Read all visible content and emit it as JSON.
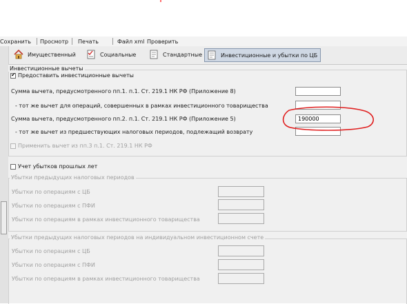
{
  "menu": {
    "items": [
      "Сохранить",
      "Просмотр",
      "Печать",
      "Файл xml",
      "Проверить"
    ]
  },
  "tabs": [
    {
      "label": "Имущественный",
      "icon": "house-icon"
    },
    {
      "label": "Социальные",
      "icon": "checklist-icon"
    },
    {
      "label": "Стандартные",
      "icon": "document-icon"
    },
    {
      "label": "Инвестиционные и убытки по ЦБ",
      "icon": "document-icon",
      "active": true
    }
  ],
  "invest": {
    "group_title": "Инвестиционные вычеты",
    "provide_label": "Предоставить инвестиционные вычеты",
    "provide_checked": true,
    "rows": [
      {
        "label": "Сумма вычета, предусмотренного пп.1. п.1. Ст. 219.1 НК РФ (Приложение 8)",
        "value": ""
      },
      {
        "label": "- тот же вычет для операций, совершенных в рамках инвестиционного товарищества",
        "value": ""
      },
      {
        "label": "Сумма вычета, предусмотренного пп.2. п.1. Ст. 219.1 НК РФ (Приложение 5)",
        "value": "190000"
      },
      {
        "label": "- тот же вычет из предшествующих налоговых периодов, подлежащий возврату",
        "value": ""
      }
    ],
    "apply_pp3_label": "Применить вычет из пп.3 п.1. Ст. 219.1 НК РФ"
  },
  "losses": {
    "checkbox_label": "Учет убытков прошлых лет",
    "prev_group_title": "Убытки предыдущих налоговых периодов",
    "prev_rows": [
      "Убытки по операциям с ЦБ",
      "Убытки по операциям с ПФИ",
      "Убытки по операциям в рамках инвестиционного товарищества"
    ],
    "iis_group_title": "Убытки предыдущих налоговых периодов на индивидуальном инвестиционном счете",
    "iis_rows": [
      "Убытки по операциям с ЦБ",
      "Убытки по операциям с ПФИ",
      "Убытки по операциям в рамках инвестиционного товарищества"
    ]
  },
  "annotation": {
    "color": "#e02020"
  }
}
